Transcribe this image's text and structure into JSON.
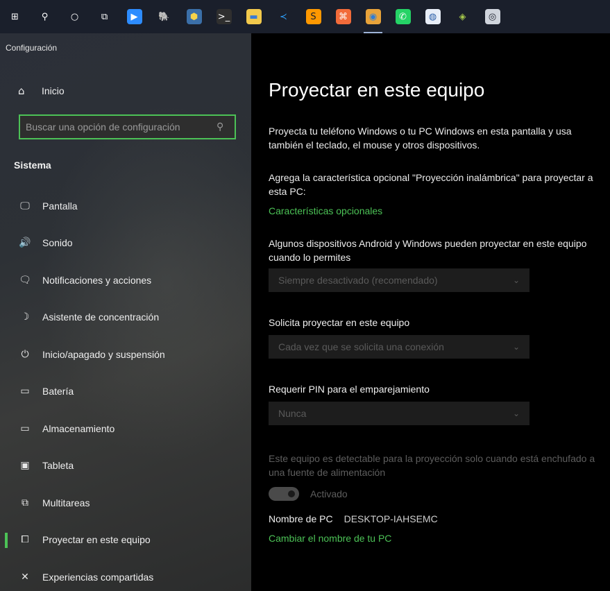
{
  "taskbar": {
    "items": [
      {
        "name": "windows-start-icon",
        "glyph": "⊞",
        "bg": "transparent",
        "color": "#ffffff"
      },
      {
        "name": "search-icon",
        "glyph": "⚲",
        "bg": "transparent",
        "color": "#ffffff"
      },
      {
        "name": "cortana-icon",
        "glyph": "○",
        "bg": "transparent",
        "color": "#ffffff"
      },
      {
        "name": "task-view-icon",
        "glyph": "⧉",
        "bg": "transparent",
        "color": "#ffffff"
      },
      {
        "name": "zoom-icon",
        "glyph": "▶",
        "bg": "#2d8cff",
        "color": "#ffffff"
      },
      {
        "name": "pgadmin-elephant-icon",
        "glyph": "🐘",
        "bg": "transparent",
        "color": "#9fb4d8"
      },
      {
        "name": "python-icon",
        "glyph": "⬢",
        "bg": "#3b6fa8",
        "color": "#f6d44a"
      },
      {
        "name": "terminal-icon",
        "glyph": ">_",
        "bg": "#2f2f2f",
        "color": "#ffffff"
      },
      {
        "name": "file-explorer-icon",
        "glyph": "▬",
        "bg": "#f2c94c",
        "color": "#3a7bd5"
      },
      {
        "name": "vscode-icon",
        "glyph": "≺",
        "bg": "#1a1f2b",
        "color": "#2e9df7"
      },
      {
        "name": "sublime-text-icon",
        "glyph": "S",
        "bg": "#ff9800",
        "color": "#1a1f2b"
      },
      {
        "name": "xampp-icon",
        "glyph": "⌘",
        "bg": "#f26b3a",
        "color": "#ffffff"
      },
      {
        "name": "chrome-icon",
        "glyph": "◉",
        "bg": "#e8a33a",
        "color": "#2e7dd6"
      },
      {
        "name": "whatsapp-icon",
        "glyph": "✆",
        "bg": "#25d366",
        "color": "#ffffff"
      },
      {
        "name": "app-round-icon",
        "glyph": "◍",
        "bg": "#e8eef8",
        "color": "#2b5fa8"
      },
      {
        "name": "paint-icon",
        "glyph": "◈",
        "bg": "transparent",
        "color": "#a6c84c"
      },
      {
        "name": "app-square-icon",
        "glyph": "◎",
        "bg": "#cfd4dc",
        "color": "#1a1f2b"
      }
    ],
    "active_index": 12
  },
  "sidebar": {
    "title": "Configuración",
    "home_label": "Inicio",
    "search_placeholder": "Buscar una opción de configuración",
    "section": "Sistema",
    "items": [
      {
        "label": "Pantalla",
        "icon": "monitor-icon",
        "glyph": "🖵"
      },
      {
        "label": "Sonido",
        "icon": "speaker-icon",
        "glyph": "🔊"
      },
      {
        "label": "Notificaciones y acciones",
        "icon": "notification-icon",
        "glyph": "🗨"
      },
      {
        "label": "Asistente de concentración",
        "icon": "moon-icon",
        "glyph": "☽"
      },
      {
        "label": "Inicio/apagado y suspensión",
        "icon": "power-icon",
        "glyph": "⏻"
      },
      {
        "label": "Batería",
        "icon": "battery-icon",
        "glyph": "▭"
      },
      {
        "label": "Almacenamiento",
        "icon": "storage-icon",
        "glyph": "▭"
      },
      {
        "label": "Tableta",
        "icon": "tablet-icon",
        "glyph": "▣"
      },
      {
        "label": "Multitareas",
        "icon": "multitasking-icon",
        "glyph": "⧉"
      },
      {
        "label": "Proyectar en este equipo",
        "icon": "project-icon",
        "glyph": "⧠",
        "selected": true
      },
      {
        "label": "Experiencias compartidas",
        "icon": "shared-icon",
        "glyph": "✕"
      }
    ]
  },
  "main": {
    "title": "Proyectar en este equipo",
    "intro": "Proyecta tu teléfono Windows o tu PC Windows en esta pantalla y usa también el teclado, el mouse y otros dispositivos.",
    "optional_text": "Agrega la característica opcional \"Proyección inalámbrica\" para proyectar a esta PC:",
    "optional_link": "Características opcionales",
    "devices_text": "Algunos dispositivos Android y Windows pueden proyectar en este equipo cuando lo permites",
    "dropdown1": "Siempre desactivado (recomendado)",
    "request_label": "Solicita proyectar en este equipo",
    "dropdown2": "Cada vez que se solicita una conexión",
    "pin_label": "Requerir PIN para el emparejamiento",
    "dropdown3": "Nunca",
    "detectable_text": "Este equipo es detectable para la proyección solo cuando está enchufado a una fuente de alimentación",
    "toggle_label": "Activado",
    "pc_name_key": "Nombre de PC",
    "pc_name_value": "DESKTOP-IAHSEMC",
    "rename_link": "Cambiar el nombre de tu PC"
  },
  "colors": {
    "accent": "#4cc256"
  }
}
